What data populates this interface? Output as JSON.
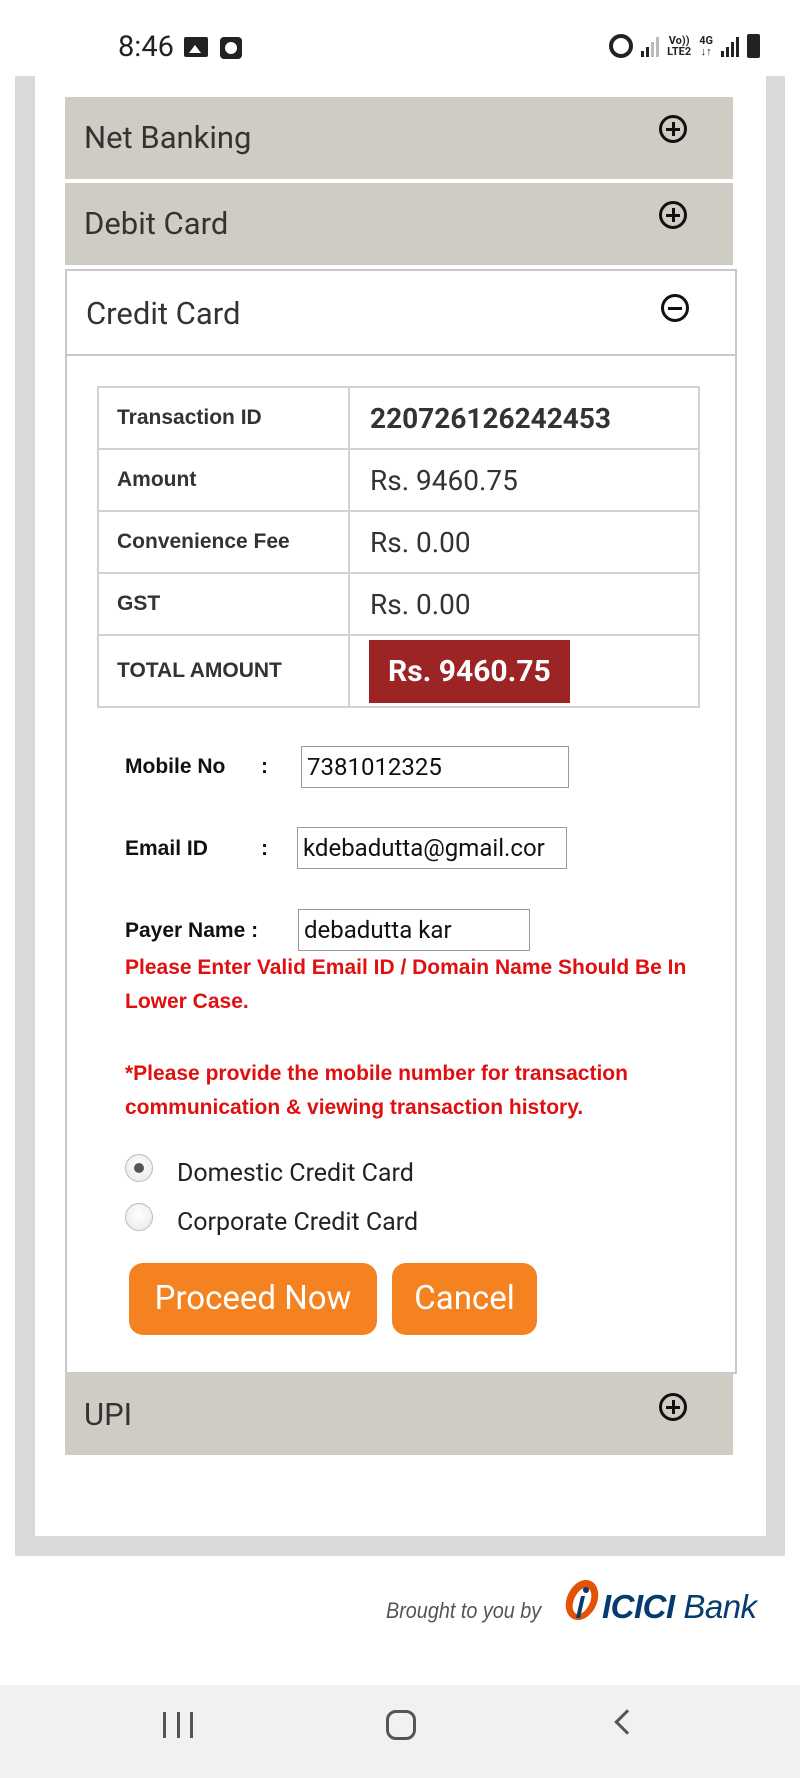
{
  "status_bar": {
    "time": "8:46",
    "network_top": "Vo))",
    "network_bottom": "LTE2",
    "data_top": "4G",
    "data_bottom": "↓↑"
  },
  "accordion": {
    "net_banking": "Net Banking",
    "debit_card": "Debit Card",
    "credit_card": "Credit Card",
    "upi": "UPI"
  },
  "summary": {
    "rows": [
      {
        "label": "Transaction ID",
        "value": "220726126242453"
      },
      {
        "label": "Amount",
        "value": "Rs. 9460.75"
      },
      {
        "label": "Convenience Fee",
        "value": "Rs. 0.00"
      },
      {
        "label": "GST",
        "value": "Rs. 0.00"
      }
    ],
    "total_label": "TOTAL AMOUNT",
    "total_value": "Rs. 9460.75"
  },
  "form": {
    "mobile_label": "Mobile No",
    "mobile_value": "7381012325",
    "email_label": "Email ID",
    "email_value": "kdebadutta@gmail.cor",
    "payer_label": "Payer Name :",
    "payer_value": "debadutta kar",
    "colon": ":",
    "email_error": "Please Enter Valid Email ID / Domain Name Should Be In Lower Case.",
    "mobile_note": "*Please provide the mobile number for transaction communication & viewing transaction history."
  },
  "card_type": {
    "options": [
      "Domestic Credit Card",
      "Corporate Credit Card"
    ],
    "selected": "Domestic Credit Card"
  },
  "buttons": {
    "proceed": "Proceed Now",
    "cancel": "Cancel"
  },
  "footer": {
    "brought_by": "Brought to you by",
    "brand_icici": "ICICI",
    "brand_bank": "Bank",
    "brand_color": "#053c6d",
    "logo_color": "#e35205"
  },
  "colors": {
    "accent_button": "#f58220",
    "total_badge": "#9c2424",
    "error_text": "#e01010",
    "accordion_header": "#cfcdc3"
  }
}
